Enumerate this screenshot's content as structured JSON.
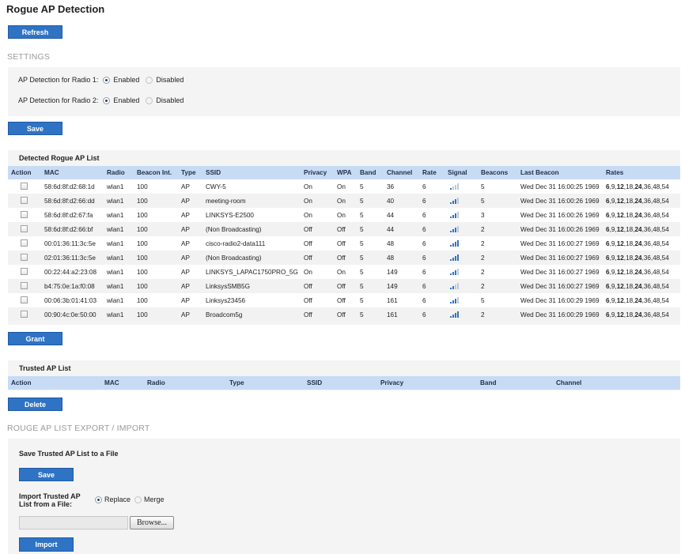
{
  "page_title": "Rogue AP Detection",
  "refresh_label": "Refresh",
  "settings": {
    "heading": "SETTINGS",
    "radio1_label": "AP Detection for Radio 1:",
    "radio2_label": "AP Detection for Radio 2:",
    "enabled": "Enabled",
    "disabled": "Disabled",
    "radio1_value": "Enabled",
    "radio2_value": "Enabled",
    "save_label": "Save"
  },
  "rogue_list": {
    "title": "Detected Rogue AP List",
    "columns": [
      "Action",
      "MAC",
      "Radio",
      "Beacon Int.",
      "Type",
      "SSID",
      "Privacy",
      "WPA",
      "Band",
      "Channel",
      "Rate",
      "Signal",
      "Beacons",
      "Last Beacon",
      "Rates"
    ],
    "rows": [
      {
        "mac": "58:6d:8f:d2:68:1d",
        "radio": "wlan1",
        "beacon_int": "100",
        "type": "AP",
        "ssid": "CWY-5",
        "privacy": "On",
        "wpa": "On",
        "band": "5",
        "channel": "36",
        "rate": "6",
        "signal": 1,
        "beacons": "5",
        "last_beacon": "Wed Dec 31 16:00:25 1969"
      },
      {
        "mac": "58:6d:8f:d2:66:dd",
        "radio": "wlan1",
        "beacon_int": "100",
        "type": "AP",
        "ssid": "meeting-room",
        "privacy": "On",
        "wpa": "On",
        "band": "5",
        "channel": "40",
        "rate": "6",
        "signal": 3,
        "beacons": "5",
        "last_beacon": "Wed Dec 31 16:00:26 1969"
      },
      {
        "mac": "58:6d:8f:d2:67:fa",
        "radio": "wlan1",
        "beacon_int": "100",
        "type": "AP",
        "ssid": "LINKSYS-E2500",
        "privacy": "On",
        "wpa": "On",
        "band": "5",
        "channel": "44",
        "rate": "6",
        "signal": 3,
        "beacons": "3",
        "last_beacon": "Wed Dec 31 16:00:26 1969"
      },
      {
        "mac": "58:6d:8f:d2:66:bf",
        "radio": "wlan1",
        "beacon_int": "100",
        "type": "AP",
        "ssid": "(Non Broadcasting)",
        "privacy": "Off",
        "wpa": "Off",
        "band": "5",
        "channel": "44",
        "rate": "6",
        "signal": 3,
        "beacons": "2",
        "last_beacon": "Wed Dec 31 16:00:26 1969"
      },
      {
        "mac": "00:01:36:11:3c:5e",
        "radio": "wlan1",
        "beacon_int": "100",
        "type": "AP",
        "ssid": "cisco-radio2-data111",
        "privacy": "Off",
        "wpa": "Off",
        "band": "5",
        "channel": "48",
        "rate": "6",
        "signal": 4,
        "beacons": "2",
        "last_beacon": "Wed Dec 31 16:00:27 1969"
      },
      {
        "mac": "02:01:36:11:3c:5e",
        "radio": "wlan1",
        "beacon_int": "100",
        "type": "AP",
        "ssid": "(Non Broadcasting)",
        "privacy": "Off",
        "wpa": "Off",
        "band": "5",
        "channel": "48",
        "rate": "6",
        "signal": 4,
        "beacons": "2",
        "last_beacon": "Wed Dec 31 16:00:27 1969"
      },
      {
        "mac": "00:22:44:a2:23:08",
        "radio": "wlan1",
        "beacon_int": "100",
        "type": "AP",
        "ssid": "LINKSYS_LAPAC1750PRO_5G",
        "privacy": "On",
        "wpa": "On",
        "band": "5",
        "channel": "149",
        "rate": "6",
        "signal": 3,
        "beacons": "2",
        "last_beacon": "Wed Dec 31 16:00:27 1969"
      },
      {
        "mac": "b4:75:0e:1a:f0:08",
        "radio": "wlan1",
        "beacon_int": "100",
        "type": "AP",
        "ssid": "LinksysSMB5G",
        "privacy": "Off",
        "wpa": "Off",
        "band": "5",
        "channel": "149",
        "rate": "6",
        "signal": 2,
        "beacons": "2",
        "last_beacon": "Wed Dec 31 16:00:27 1969"
      },
      {
        "mac": "00:06:3b:01:41:03",
        "radio": "wlan1",
        "beacon_int": "100",
        "type": "AP",
        "ssid": "Linksys23456",
        "privacy": "Off",
        "wpa": "Off",
        "band": "5",
        "channel": "161",
        "rate": "6",
        "signal": 3,
        "beacons": "5",
        "last_beacon": "Wed Dec 31 16:00:29 1969"
      },
      {
        "mac": "00:90:4c:0e:50:00",
        "radio": "wlan1",
        "beacon_int": "100",
        "type": "AP",
        "ssid": "Broadcom5g",
        "privacy": "Off",
        "wpa": "Off",
        "band": "5",
        "channel": "161",
        "rate": "6",
        "signal": 4,
        "beacons": "2",
        "last_beacon": "Wed Dec 31 16:00:29 1969"
      }
    ],
    "rates_parts": [
      {
        "text": "6",
        "bold": true
      },
      {
        "text": ",",
        "bold": false
      },
      {
        "text": "9",
        "bold": false
      },
      {
        "text": ",",
        "bold": false
      },
      {
        "text": "12",
        "bold": true
      },
      {
        "text": ",",
        "bold": false
      },
      {
        "text": "18",
        "bold": false
      },
      {
        "text": ",",
        "bold": false
      },
      {
        "text": "24",
        "bold": true
      },
      {
        "text": ",",
        "bold": false
      },
      {
        "text": "36",
        "bold": false
      },
      {
        "text": ",",
        "bold": false
      },
      {
        "text": "48",
        "bold": false
      },
      {
        "text": ",",
        "bold": false
      },
      {
        "text": "54",
        "bold": false
      }
    ],
    "grant_label": "Grant"
  },
  "trusted_list": {
    "title": "Trusted AP List",
    "columns": [
      "Action",
      "MAC",
      "Radio",
      "Type",
      "SSID",
      "Privacy",
      "Band",
      "Channel"
    ],
    "delete_label": "Delete"
  },
  "export_import": {
    "heading": "ROUGE AP LIST EXPORT / IMPORT",
    "save_title": "Save Trusted AP List to a File",
    "save_label": "Save",
    "import_label_line1": "Import Trusted AP",
    "import_label_line2": "List from a File:",
    "replace": "Replace",
    "merge": "Merge",
    "selected_mode": "Replace",
    "file_value": "",
    "browse_label": "Browse...",
    "import_button": "Import"
  },
  "colors": {
    "button": "#2f73c4",
    "table_header": "#c7dbf5",
    "panel": "#f4f4f4",
    "signal": "#2f73c4"
  }
}
